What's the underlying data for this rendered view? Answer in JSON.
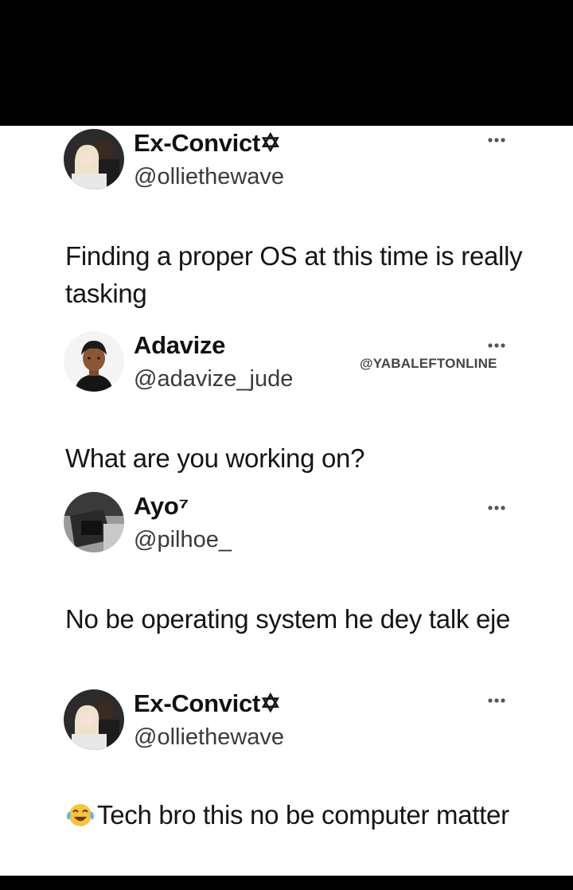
{
  "watermark": "@YABALEFTONLINE",
  "tweets": [
    {
      "display_name": "Ex-Convict✡︎",
      "username": "@olliethewave",
      "text": "Finding  a proper OS at this time is really tasking"
    },
    {
      "display_name": "Adavize",
      "username": "@adavize_jude",
      "text": "What are you working on?"
    },
    {
      "display_name": "Ayo⁷",
      "username": "@pilhoe_",
      "text": "No be operating system he dey talk eje"
    },
    {
      "display_name": "Ex-Convict✡︎",
      "username": "@olliethewave",
      "emoji": "face-with-tears-of-joy-icon",
      "text": "Tech bro this no be computer matter"
    }
  ]
}
